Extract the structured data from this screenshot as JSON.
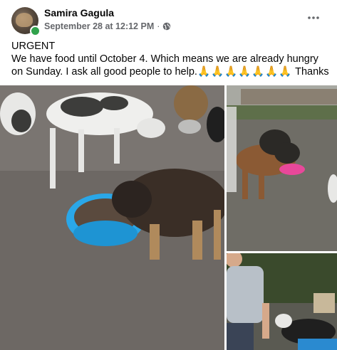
{
  "author": {
    "name": "Samira Gagula",
    "timestamp": "September 28 at 12:12 PM",
    "separator": "·",
    "privacy_icon": "globe-icon",
    "online_status_color": "#31a24c"
  },
  "menu": {
    "icon": "more-options-icon"
  },
  "post": {
    "line1": "URGENT",
    "line2": "We have food until October 4. Which means we are already hungry on Sunday. I ask all good people to help.",
    "emoji": "🙏🙏🙏🙏🙏🙏🙏",
    "line2_end": " Thanks"
  },
  "photos": [
    {
      "name": "photo-dogs-eating-blue-bowl"
    },
    {
      "name": "photo-dogs-pink-bowl"
    },
    {
      "name": "photo-man-with-dogs"
    }
  ],
  "colors": {
    "secondary_text": "#65676b",
    "primary_text": "#050505"
  }
}
